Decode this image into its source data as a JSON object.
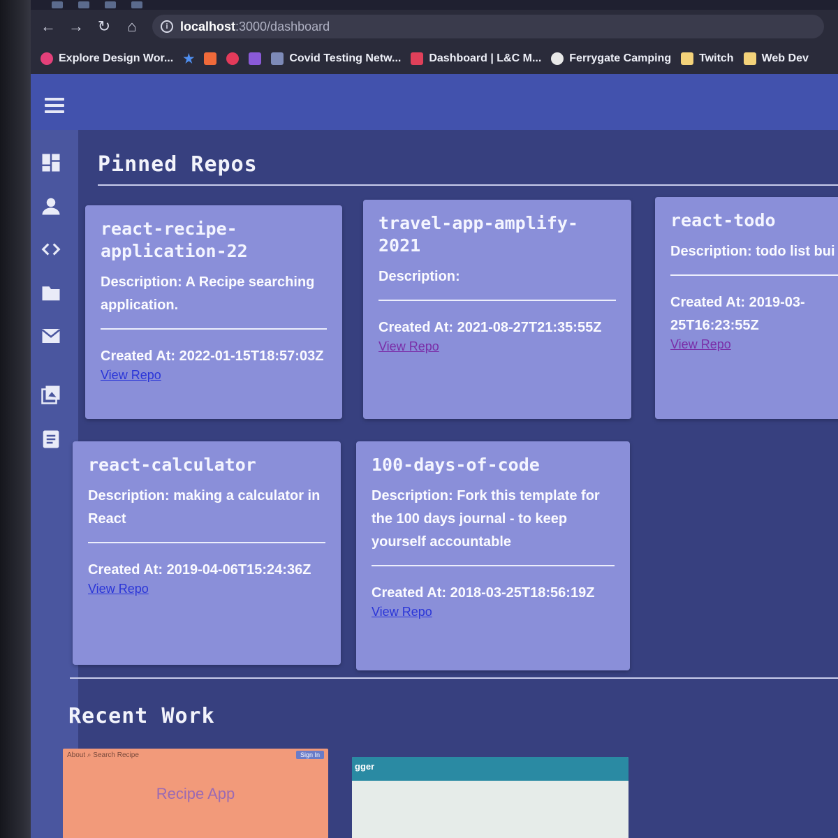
{
  "browser": {
    "url_host": "localhost",
    "url_path": ":3000/dashboard",
    "bookmarks": [
      {
        "label": "Explore Design Wor...",
        "color": "#e4407a"
      },
      {
        "label": "Covid Testing Netw...",
        "color": "#7d8ab8"
      },
      {
        "label": "Dashboard | L&C M...",
        "color": "#e0405a"
      },
      {
        "label": "Ferrygate Camping",
        "color": "#e8e8e8"
      },
      {
        "label": "Twitch",
        "color": "#f3d27a"
      },
      {
        "label": "Web Dev",
        "color": "#f3d27a"
      }
    ]
  },
  "sidebar": {
    "icons": [
      "dashboard-icon",
      "person-icon",
      "code-icon",
      "folder-icon",
      "mail-icon",
      "photo-library-icon",
      "article-icon"
    ]
  },
  "pinned": {
    "title": "Pinned Repos",
    "repos": [
      {
        "name": "react-recipe-\napplication-22",
        "description": "Description: A Recipe searching application.",
        "created": "Created At: 2022-01-15T18:57:03Z",
        "link": "View Repo"
      },
      {
        "name": "travel-app-amplify-\n2021",
        "description": "Description:",
        "created": "Created At: 2021-08-27T21:35:55Z",
        "link": "View Repo"
      },
      {
        "name": "react-todo",
        "description": "Description: todo list bui",
        "created": "Created At: 2019-03-25T16:23:55Z",
        "link": "View Repo"
      },
      {
        "name": "react-calculator",
        "description": "Description: making a calculator in React",
        "created": "Created At: 2019-04-06T15:24:36Z",
        "link": "View Repo"
      },
      {
        "name": "100-days-of-code",
        "description": "Description: Fork this template for the 100 days journal - to keep yourself accountable",
        "created": "Created At: 2018-03-25T18:56:19Z",
        "link": "View Repo"
      }
    ]
  },
  "recent": {
    "title": "Recent Work",
    "items": [
      {
        "nav_text": "About  ⌕ Search Recipe",
        "signin": "Sign In",
        "app_title": "Recipe App"
      },
      {
        "header_text": "gger"
      }
    ]
  }
}
